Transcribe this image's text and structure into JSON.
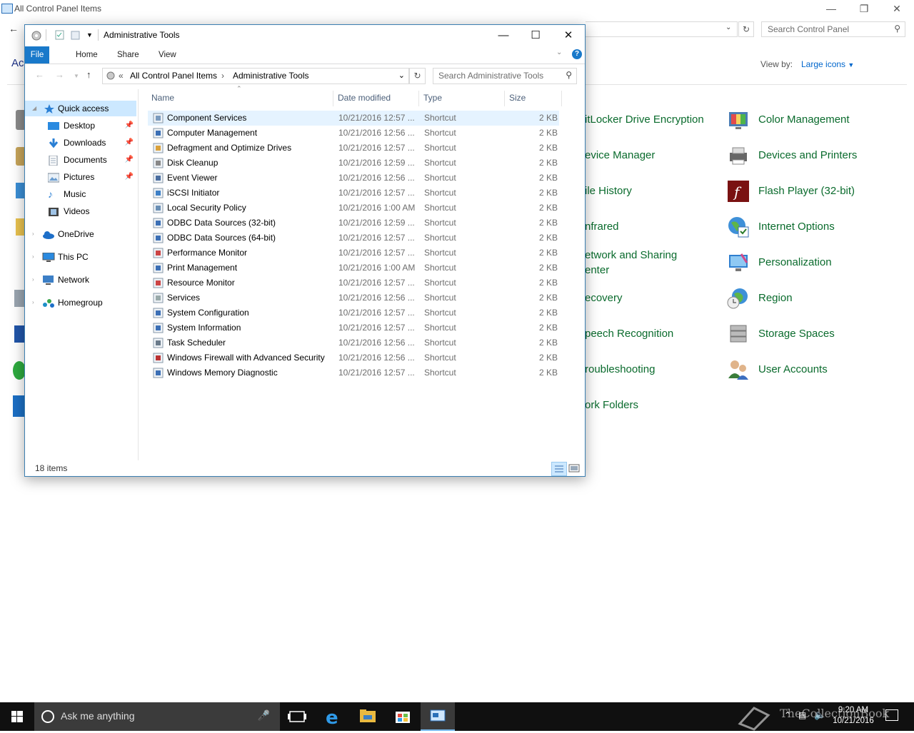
{
  "background_window": {
    "title": "All Control Panel Items",
    "heading": "Ac",
    "search_placeholder": "Search Control Panel",
    "view_by_label": "View by:",
    "view_by_value": "Large icons",
    "items": [
      {
        "label": "itLocker Drive Encryption",
        "icon": "bitlocker-icon"
      },
      {
        "label": "Color Management",
        "icon": "color-management-icon"
      },
      {
        "label": "evice Manager",
        "icon": "device-manager-icon"
      },
      {
        "label": "Devices and Printers",
        "icon": "printer-icon"
      },
      {
        "label": "ile History",
        "icon": "file-history-icon"
      },
      {
        "label": "Flash Player (32-bit)",
        "icon": "flash-icon"
      },
      {
        "label": "nfrared",
        "icon": "infrared-icon"
      },
      {
        "label": "Internet Options",
        "icon": "internet-options-icon"
      },
      {
        "label": "etwork and Sharing",
        "label2": "enter",
        "icon": "network-icon"
      },
      {
        "label": "Personalization",
        "icon": "personalization-icon"
      },
      {
        "label": "ecovery",
        "icon": "recovery-icon"
      },
      {
        "label": "Region",
        "icon": "region-icon"
      },
      {
        "label": "peech Recognition",
        "icon": "speech-icon"
      },
      {
        "label": "Storage Spaces",
        "icon": "storage-icon"
      },
      {
        "label": "roubleshooting",
        "icon": "troubleshooting-icon"
      },
      {
        "label": "User Accounts",
        "icon": "user-accounts-icon"
      },
      {
        "label": "ork Folders",
        "icon": "work-folders-icon"
      }
    ]
  },
  "explorer": {
    "title": "Administrative Tools",
    "ribbon_tabs": [
      "File",
      "Home",
      "Share",
      "View"
    ],
    "address": {
      "prefix": "«",
      "crumbs": [
        "All Control Panel Items",
        "›",
        "Administrative Tools"
      ]
    },
    "search_placeholder": "Search Administrative Tools",
    "nav": [
      {
        "label": "Quick access",
        "icon": "star-icon",
        "selected": true
      },
      {
        "label": "Desktop",
        "icon": "desktop-icon",
        "pinned": true
      },
      {
        "label": "Downloads",
        "icon": "download-icon",
        "pinned": true
      },
      {
        "label": "Documents",
        "icon": "documents-icon",
        "pinned": true
      },
      {
        "label": "Pictures",
        "icon": "pictures-icon",
        "pinned": true
      },
      {
        "label": "Music",
        "icon": "music-icon"
      },
      {
        "label": "Videos",
        "icon": "videos-icon"
      },
      {
        "label": "OneDrive",
        "icon": "onedrive-icon"
      },
      {
        "label": "This PC",
        "icon": "computer-icon"
      },
      {
        "label": "Network",
        "icon": "network-icon"
      },
      {
        "label": "Homegroup",
        "icon": "homegroup-icon"
      }
    ],
    "columns": [
      "Name",
      "Date modified",
      "Type",
      "Size"
    ],
    "files": [
      {
        "name": "Component Services",
        "date": "10/21/2016 12:57 ...",
        "type": "Shortcut",
        "size": "2 KB",
        "selected": true
      },
      {
        "name": "Computer Management",
        "date": "10/21/2016 12:56 ...",
        "type": "Shortcut",
        "size": "2 KB"
      },
      {
        "name": "Defragment and Optimize Drives",
        "date": "10/21/2016 12:57 ...",
        "type": "Shortcut",
        "size": "2 KB"
      },
      {
        "name": "Disk Cleanup",
        "date": "10/21/2016 12:59 ...",
        "type": "Shortcut",
        "size": "2 KB"
      },
      {
        "name": "Event Viewer",
        "date": "10/21/2016 12:56 ...",
        "type": "Shortcut",
        "size": "2 KB"
      },
      {
        "name": "iSCSI Initiator",
        "date": "10/21/2016 12:57 ...",
        "type": "Shortcut",
        "size": "2 KB"
      },
      {
        "name": "Local Security Policy",
        "date": "10/21/2016 1:00 AM",
        "type": "Shortcut",
        "size": "2 KB"
      },
      {
        "name": "ODBC Data Sources (32-bit)",
        "date": "10/21/2016 12:59 ...",
        "type": "Shortcut",
        "size": "2 KB"
      },
      {
        "name": "ODBC Data Sources (64-bit)",
        "date": "10/21/2016 12:57 ...",
        "type": "Shortcut",
        "size": "2 KB"
      },
      {
        "name": "Performance Monitor",
        "date": "10/21/2016 12:57 ...",
        "type": "Shortcut",
        "size": "2 KB"
      },
      {
        "name": "Print Management",
        "date": "10/21/2016 1:00 AM",
        "type": "Shortcut",
        "size": "2 KB"
      },
      {
        "name": "Resource Monitor",
        "date": "10/21/2016 12:57 ...",
        "type": "Shortcut",
        "size": "2 KB"
      },
      {
        "name": "Services",
        "date": "10/21/2016 12:56 ...",
        "type": "Shortcut",
        "size": "2 KB"
      },
      {
        "name": "System Configuration",
        "date": "10/21/2016 12:57 ...",
        "type": "Shortcut",
        "size": "2 KB"
      },
      {
        "name": "System Information",
        "date": "10/21/2016 12:57 ...",
        "type": "Shortcut",
        "size": "2 KB"
      },
      {
        "name": "Task Scheduler",
        "date": "10/21/2016 12:56 ...",
        "type": "Shortcut",
        "size": "2 KB"
      },
      {
        "name": "Windows Firewall with Advanced Security",
        "date": "10/21/2016 12:56 ...",
        "type": "Shortcut",
        "size": "2 KB"
      },
      {
        "name": "Windows Memory Diagnostic",
        "date": "10/21/2016 12:57 ...",
        "type": "Shortcut",
        "size": "2 KB"
      }
    ],
    "status": "18 items"
  },
  "taskbar": {
    "search_placeholder": "Ask me anything",
    "time": "9:20 AM",
    "date": "10/21/2016",
    "watermark": "TheCollectionBook"
  },
  "colors": {
    "accent": "#1979ca",
    "link_green": "#0a6b2d",
    "selection": "#e5f3ff",
    "taskbar": "#101010"
  }
}
